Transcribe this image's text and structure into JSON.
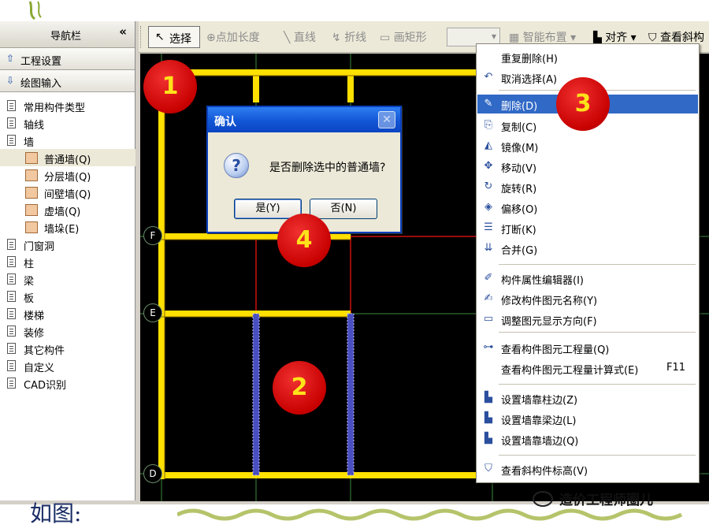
{
  "navigation": {
    "title": "导航栏",
    "collapse": "«",
    "sections": [
      {
        "label": "工程设置",
        "arrow": "⇧"
      },
      {
        "label": "绘图输入",
        "arrow": "⇩"
      }
    ],
    "tree": [
      {
        "label": "常用构件类型",
        "level": 1
      },
      {
        "label": "轴线",
        "level": 1
      },
      {
        "label": "墙",
        "level": 1
      },
      {
        "label": "普通墙(Q)",
        "level": 2,
        "selected": true
      },
      {
        "label": "分层墙(Q)",
        "level": 2
      },
      {
        "label": "间壁墙(Q)",
        "level": 2
      },
      {
        "label": "虚墙(Q)",
        "level": 2
      },
      {
        "label": "墙垛(E)",
        "level": 2
      },
      {
        "label": "门窗洞",
        "level": 1
      },
      {
        "label": "柱",
        "level": 1
      },
      {
        "label": "梁",
        "level": 1
      },
      {
        "label": "板",
        "level": 1
      },
      {
        "label": "楼梯",
        "level": 1
      },
      {
        "label": "装修",
        "level": 1
      },
      {
        "label": "其它构件",
        "level": 1
      },
      {
        "label": "自定义",
        "level": 1
      },
      {
        "label": "CAD识别",
        "level": 1
      }
    ]
  },
  "toolbar": {
    "select": "选择",
    "point_length": "点加长度",
    "line": "直线",
    "polyline": "折线",
    "rectangle": "画矩形",
    "smart_layout": "智能布置",
    "align": "对齐",
    "view_slope": "查看斜构"
  },
  "canvas": {
    "axis_labels": [
      "F",
      "E",
      "D"
    ]
  },
  "dialog": {
    "title": "确认",
    "message": "是否删除选中的普通墙?",
    "yes": "是(Y)",
    "no": "否(N)"
  },
  "context_menu": {
    "items": [
      {
        "label": "重复删除(H)",
        "icon": "none"
      },
      {
        "label": "取消选择(A)",
        "icon": "undo-icon"
      },
      {
        "label": "删除(D)",
        "icon": "eraser-icon",
        "highlighted": true
      },
      {
        "label": "复制(C)",
        "icon": "copy-icon"
      },
      {
        "label": "镜像(M)",
        "icon": "mirror-icon"
      },
      {
        "label": "移动(V)",
        "icon": "move-icon"
      },
      {
        "label": "旋转(R)",
        "icon": "rotate-icon"
      },
      {
        "label": "偏移(O)",
        "icon": "offset-icon"
      },
      {
        "label": "打断(K)",
        "icon": "break-icon"
      },
      {
        "label": "合并(G)",
        "icon": "merge-icon"
      },
      {
        "label": "构件属性编辑器(I)",
        "icon": "edit-icon"
      },
      {
        "label": "修改构件图元名称(Y)",
        "icon": "rename-icon"
      },
      {
        "label": "调整图元显示方向(F)",
        "icon": "direction-icon"
      },
      {
        "label": "查看构件图元工程量(Q)",
        "icon": "quantity-icon"
      },
      {
        "label": "查看构件图元工程量计算式(E)",
        "icon": "none",
        "shortcut": "F11"
      },
      {
        "label": "设置墙靠柱边(Z)",
        "icon": "align-icon"
      },
      {
        "label": "设置墙靠梁边(L)",
        "icon": "align-icon"
      },
      {
        "label": "设置墙靠墙边(Q)",
        "icon": "align-icon"
      },
      {
        "label": "查看斜构件标高(V)",
        "icon": "slope-icon"
      }
    ]
  },
  "callouts": [
    "1",
    "2",
    "3",
    "4"
  ],
  "caption": "如图:",
  "watermark": "造价工程师圈儿",
  "colors": {
    "wall": "#ffe000",
    "selected_wall": "#4a4fc0",
    "callout": "#d40000",
    "callout_text": "#ffe21a",
    "menu_highlight": "#3169c6",
    "dialog_title": "#1256d6"
  }
}
